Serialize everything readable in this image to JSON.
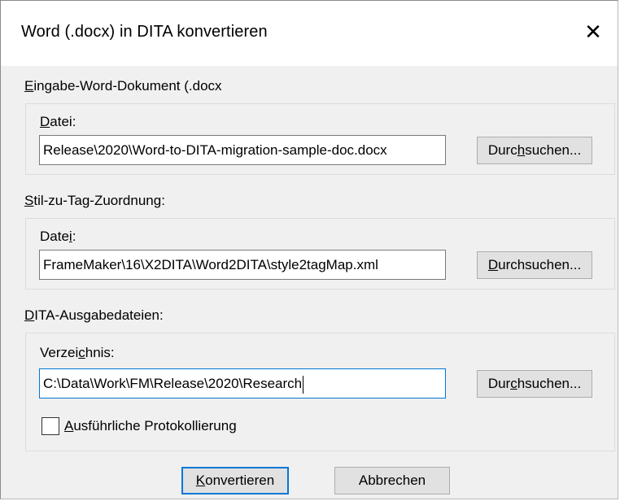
{
  "window": {
    "title": "Word (.docx) in DITA konvertieren",
    "close_icon": "close-icon"
  },
  "input_section": {
    "label_pre": "",
    "label_accel": "E",
    "label_post": "ingabe-Word-Dokument (.docx",
    "field_label_pre": "",
    "field_label_accel": "D",
    "field_label_post": "atei:",
    "value": "Release\\2020\\Word-to-DITA-migration-sample-doc.docx",
    "browse_pre": "Durc",
    "browse_accel": "h",
    "browse_post": "suchen..."
  },
  "mapping_section": {
    "label_pre": "",
    "label_accel": "S",
    "label_post": "til-zu-Tag-Zuordnung:",
    "field_label_pre": "Date",
    "field_label_accel": "i",
    "field_label_post": ":",
    "value": "FrameMaker\\16\\X2DITA\\Word2DITA\\style2tagMap.xml",
    "browse_pre": "",
    "browse_accel": "D",
    "browse_post": "urchsuchen..."
  },
  "output_section": {
    "label_pre": "",
    "label_accel": "D",
    "label_post": "ITA-Ausgabedateien:",
    "field_label_pre": "Verzei",
    "field_label_accel": "c",
    "field_label_post": "hnis:",
    "value": "C:\\Data\\Work\\FM\\Release\\2020\\Research",
    "browse_pre": "Dur",
    "browse_accel": "c",
    "browse_post": "hsuchen...",
    "checkbox_label_pre": "",
    "checkbox_label_accel": "A",
    "checkbox_label_post": "usführliche Protokollierung",
    "checkbox_checked": false
  },
  "footer": {
    "convert_pre": "",
    "convert_accel": "K",
    "convert_post": "onvertieren",
    "cancel_label": "Abbrechen"
  },
  "colors": {
    "dialog_bg": "#f0f0f0",
    "focus_accent": "#0078d7",
    "button_bg": "#e1e1e1"
  }
}
